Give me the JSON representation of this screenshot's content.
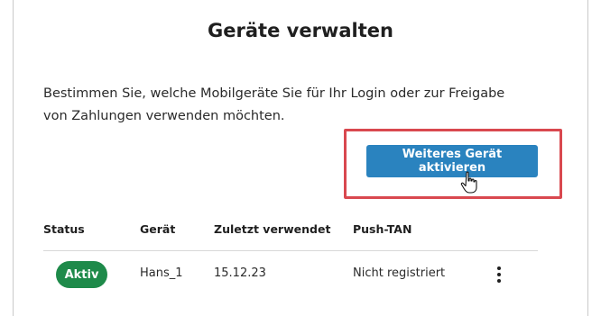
{
  "page": {
    "title": "Geräte verwalten",
    "description": "Bestimmen Sie, welche Mobilgeräte Sie für Ihr Login oder zur Freigabe von Zahlungen verwenden möchten.",
    "activate_button_label": "Weiteres Gerät aktivieren"
  },
  "table": {
    "headers": [
      "Status",
      "Gerät",
      "Zuletzt verwendet",
      "Push-TAN"
    ],
    "rows": [
      {
        "status": "Aktiv",
        "device": "Hans_1",
        "last_used": "15.12.23",
        "push_tan": "Nicht registriert"
      }
    ]
  },
  "colors": {
    "primary_button": "#2a83bf",
    "status_active": "#1e8a4a",
    "highlight_border": "#d9484f"
  },
  "icons": {
    "cursor": "hand-pointer-icon",
    "row_menu": "more-vertical-icon"
  }
}
